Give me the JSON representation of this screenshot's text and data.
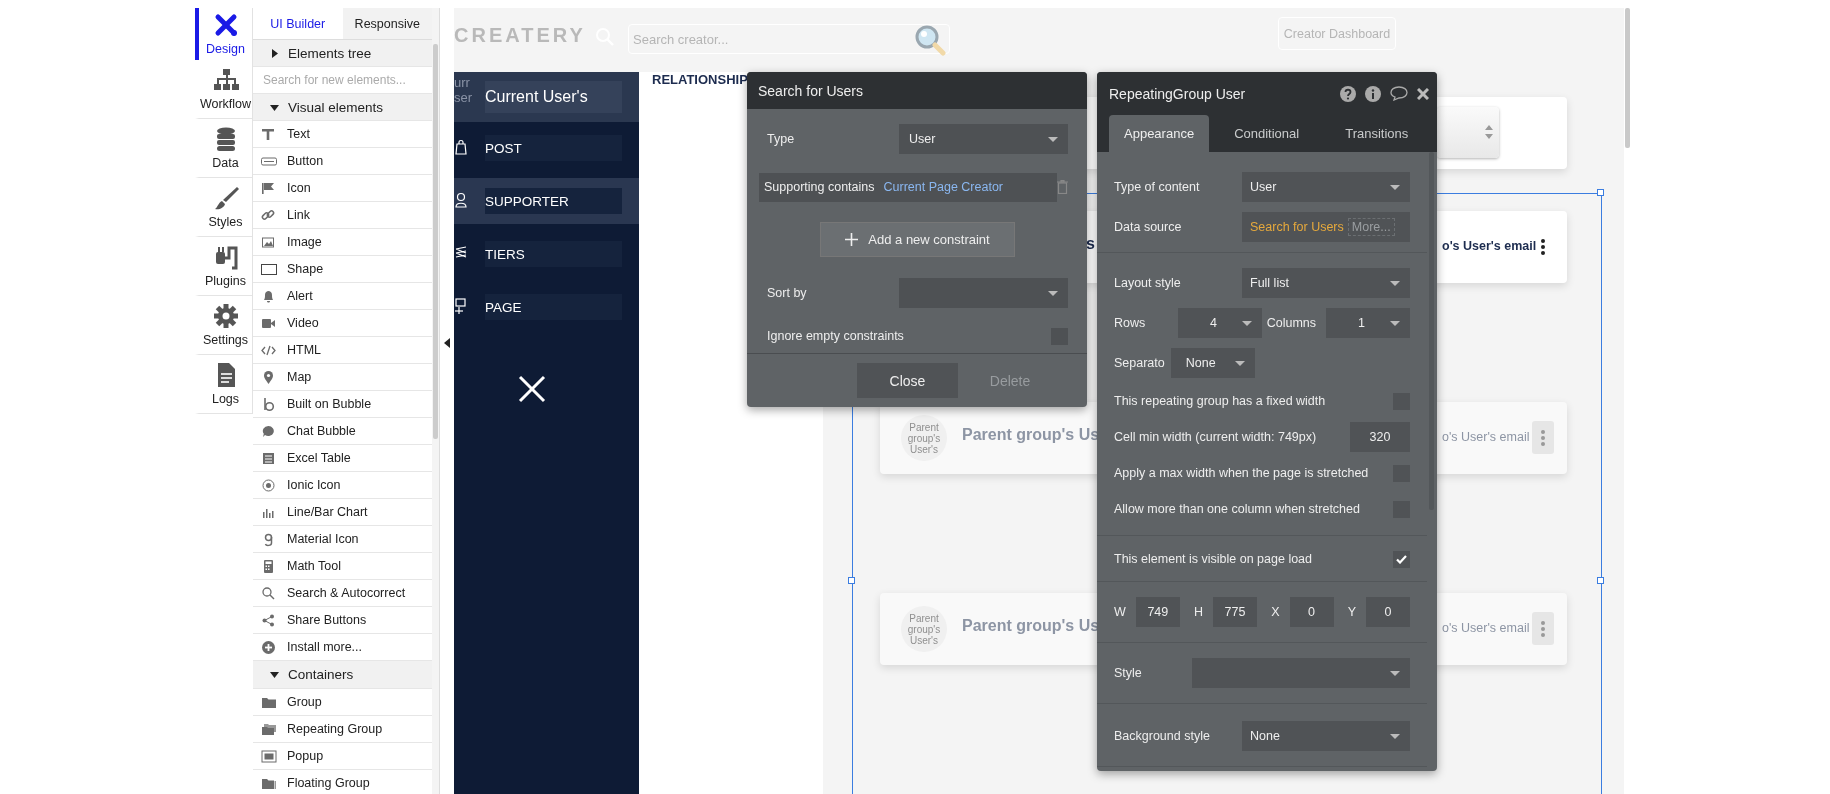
{
  "sidebar_nav": [
    {
      "label": "Design",
      "selected": true
    },
    {
      "label": "Workflow",
      "selected": false
    },
    {
      "label": "Data",
      "selected": false
    },
    {
      "label": "Styles",
      "selected": false
    },
    {
      "label": "Plugins",
      "selected": false
    },
    {
      "label": "Settings",
      "selected": false
    },
    {
      "label": "Logs",
      "selected": false
    }
  ],
  "element_panel": {
    "tabs": [
      {
        "label": "UI Builder",
        "selected": true
      },
      {
        "label": "Responsive",
        "selected": false
      }
    ],
    "rows": [
      {
        "kind": "header",
        "label": "Elements tree",
        "expanded": false
      },
      {
        "kind": "search",
        "placeholder": "Search for new elements..."
      },
      {
        "kind": "header",
        "label": "Visual elements",
        "expanded": true
      },
      {
        "kind": "item",
        "label": "Text"
      },
      {
        "kind": "item",
        "label": "Button"
      },
      {
        "kind": "item",
        "label": "Icon"
      },
      {
        "kind": "item",
        "label": "Link"
      },
      {
        "kind": "item",
        "label": "Image"
      },
      {
        "kind": "item",
        "label": "Shape"
      },
      {
        "kind": "item",
        "label": "Alert"
      },
      {
        "kind": "item",
        "label": "Video"
      },
      {
        "kind": "item",
        "label": "HTML"
      },
      {
        "kind": "item",
        "label": "Map"
      },
      {
        "kind": "item",
        "label": "Built on Bubble"
      },
      {
        "kind": "item",
        "label": "Chat Bubble"
      },
      {
        "kind": "item",
        "label": "Excel Table"
      },
      {
        "kind": "item",
        "label": "Ionic Icon"
      },
      {
        "kind": "item",
        "label": "Line/Bar Chart"
      },
      {
        "kind": "item",
        "label": "Material Icon"
      },
      {
        "kind": "item",
        "label": "Math Tool"
      },
      {
        "kind": "item",
        "label": "Search & Autocorrect"
      },
      {
        "kind": "item",
        "label": "Share Buttons"
      },
      {
        "kind": "item",
        "label": "Install more..."
      },
      {
        "kind": "header",
        "label": "Containers",
        "expanded": true
      },
      {
        "kind": "item",
        "label": "Group"
      },
      {
        "kind": "item",
        "label": "Repeating Group"
      },
      {
        "kind": "item",
        "label": "Popup"
      },
      {
        "kind": "item",
        "label": "Floating Group"
      }
    ]
  },
  "canvas": {
    "logo": "CREATERY",
    "search_placeholder": "Search creator...",
    "dashboard_button": "Creator Dashboard",
    "menu": {
      "avatar_text": [
        "urr",
        "ser"
      ],
      "header": "Current User's",
      "items": [
        {
          "label": "POST",
          "selected": false
        },
        {
          "label": "SUPPORTER",
          "selected": true
        },
        {
          "label": "TIERS",
          "selected": false
        },
        {
          "label": "PAGE",
          "selected": false
        }
      ]
    },
    "heading": "RELATIONSHIP",
    "cards": [
      {
        "kind": "dropdown"
      },
      {
        "kind": "user",
        "faded": false,
        "name": "s",
        "email": "o's User's email"
      },
      {
        "kind": "user",
        "faded": true,
        "avatar_text": "Parent group's User's",
        "name": "Parent group's Us",
        "email": "o's User's email"
      },
      {
        "kind": "user",
        "faded": true,
        "avatar_text": "Parent group's User's",
        "name": "Parent group's Us",
        "email": "o's User's email"
      }
    ]
  },
  "search_popup": {
    "title": "Search for Users",
    "rows": [
      {
        "kind": "dropdown",
        "label": "Type",
        "value": "User"
      },
      {
        "kind": "constraint",
        "label": "Supporting contains",
        "value": "Current Page Creator"
      },
      {
        "kind": "add",
        "label": "Add a new constraint"
      },
      {
        "kind": "dropdown",
        "label": "Sort by"
      },
      {
        "kind": "checkbox",
        "label": "Ignore empty constraints",
        "checked": false
      }
    ],
    "buttons": [
      {
        "label": "Close",
        "disabled": false
      },
      {
        "label": "Delete",
        "disabled": true
      }
    ]
  },
  "property_panel": {
    "title": "RepeatingGroup User",
    "tabs": [
      {
        "label": "Appearance",
        "selected": true
      },
      {
        "label": "Conditional",
        "selected": false
      },
      {
        "label": "Transitions",
        "selected": false
      }
    ],
    "sections": [
      {
        "rows": [
          {
            "kind": "dropdown",
            "label": "Type of content",
            "value": "User"
          },
          {
            "kind": "source",
            "label": "Data source",
            "value": "Search for Users",
            "more": "More..."
          }
        ]
      },
      {
        "rows": [
          {
            "kind": "dropdown",
            "label": "Layout style",
            "value": "Full list"
          },
          {
            "kind": "pair",
            "items": [
              {
                "label": "Rows",
                "value": "4"
              },
              {
                "label": "Columns",
                "value": "1"
              }
            ]
          },
          {
            "kind": "small_dropdown",
            "label": "Separato",
            "value": "None"
          },
          {
            "kind": "checkbox",
            "label": "This repeating group has a fixed width",
            "checked": false
          },
          {
            "kind": "number",
            "label": "Cell min width (current width: 749px)",
            "value": "320"
          },
          {
            "kind": "checkbox",
            "label": "Apply a max width when the page is stretched",
            "checked": false
          },
          {
            "kind": "checkbox",
            "label": "Allow more than one column when stretched",
            "checked": false
          }
        ]
      },
      {
        "rows": [
          {
            "kind": "checkbox",
            "label": "This element is visible on page load",
            "checked": true
          }
        ]
      },
      {
        "rows": [
          {
            "kind": "dims",
            "items": [
              {
                "label": "W",
                "value": "749"
              },
              {
                "label": "H",
                "value": "775"
              },
              {
                "label": "X",
                "value": "0"
              },
              {
                "label": "Y",
                "value": "0"
              }
            ]
          }
        ]
      },
      {
        "rows": [
          {
            "kind": "wide_dropdown",
            "label": "Style"
          }
        ]
      },
      {
        "rows": [
          {
            "kind": "dropdown",
            "label": "Background style",
            "value": "None"
          }
        ]
      }
    ]
  }
}
